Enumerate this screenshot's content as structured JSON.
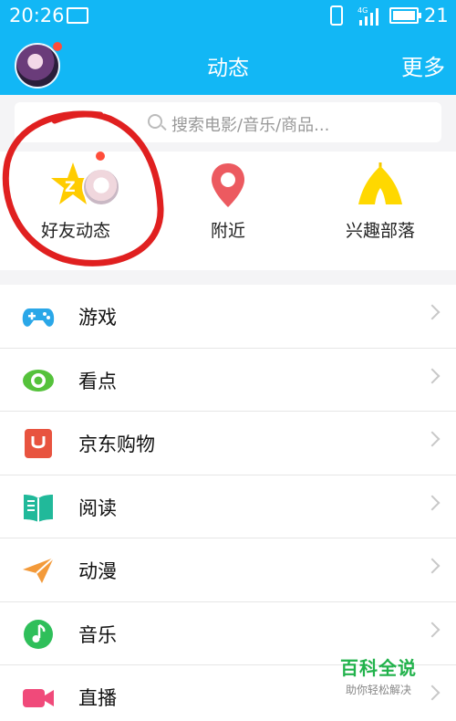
{
  "status_bar": {
    "time": "20:26",
    "network": "4G",
    "battery": "21"
  },
  "header": {
    "title": "动态",
    "more": "更多"
  },
  "search": {
    "placeholder": "搜索电影/音乐/商品..."
  },
  "quick_items": [
    {
      "label": "好友动态",
      "icon": "qzone-star-icon"
    },
    {
      "label": "附近",
      "icon": "location-pin-icon"
    },
    {
      "label": "兴趣部落",
      "icon": "tent-icon"
    }
  ],
  "menu": [
    {
      "label": "游戏",
      "icon": "gamepad-icon",
      "color": "#2aa7e8"
    },
    {
      "label": "看点",
      "icon": "eye-icon",
      "color": "#55c23b"
    },
    {
      "label": "京东购物",
      "icon": "jd-bag-icon",
      "color": "#e8533f"
    },
    {
      "label": "阅读",
      "icon": "book-icon",
      "color": "#21b99a"
    },
    {
      "label": "动漫",
      "icon": "paper-plane-icon",
      "color": "#f39a3a"
    },
    {
      "label": "音乐",
      "icon": "music-note-icon",
      "color": "#2fbf5a"
    },
    {
      "label": "直播",
      "icon": "video-camera-icon",
      "color": "#f04a7a"
    }
  ],
  "watermark": {
    "title": "百科全说",
    "subtitle": "助你轻松解决"
  },
  "colors": {
    "header_bg": "#12b7f5",
    "badge_red": "#ff4d3a",
    "annotation_red": "#e02020"
  }
}
